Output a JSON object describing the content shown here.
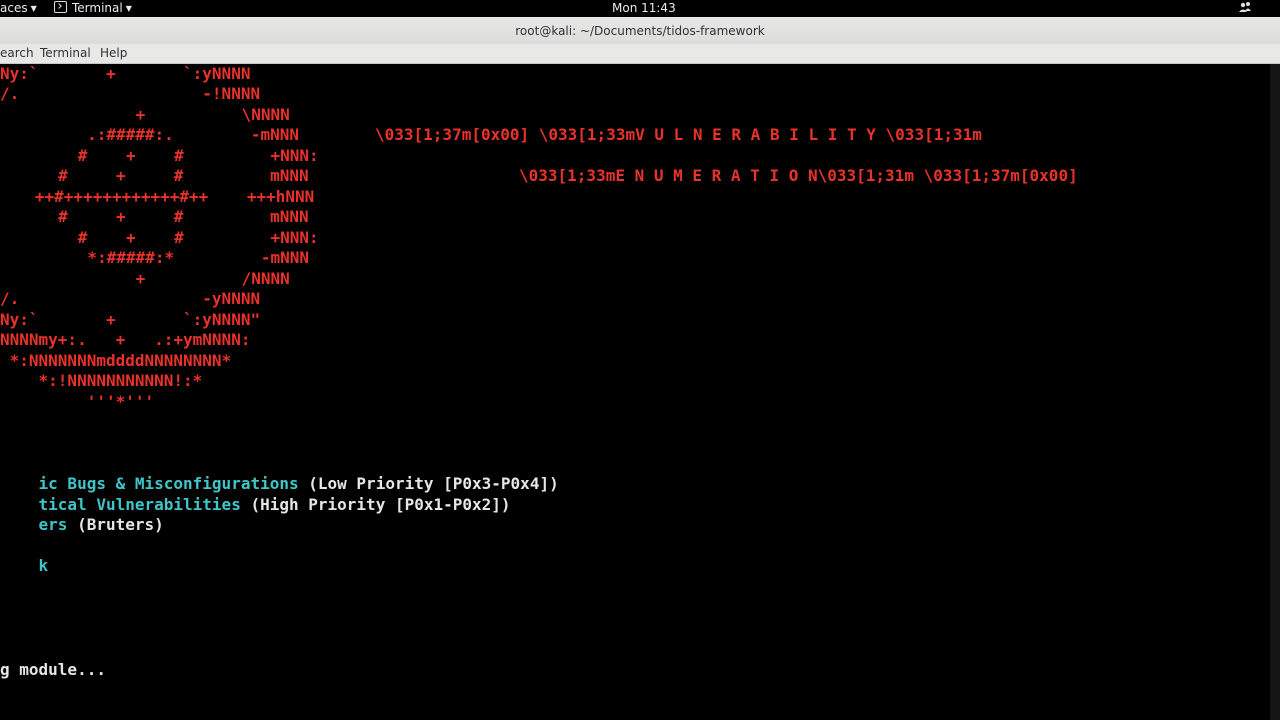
{
  "topbar": {
    "activities": "aces",
    "app_menu": "Terminal",
    "clock": "Mon 11:43",
    "tray_icon": "network-users-icon"
  },
  "window": {
    "title": "root@kali: ~/Documents/tidos-framework"
  },
  "menubar": {
    "search": "earch",
    "terminal": "Terminal",
    "help": "Help"
  },
  "colors": {
    "banner_red": "#e8322b",
    "menu_cyan": "#3fc6c8",
    "text_white": "#e6e6e6"
  },
  "banner_art": [
    "Ny:`       +       `:yNNNN",
    "/.                   -!NNNN",
    "            +          \\NNNN",
    "        .:#####:.        -mNNN",
    "      #    +    #         +NNN:",
    "     #     +     #         mNNN",
    "   ++#++++++++++++#++    +++hNNN",
    "     #     +     #         mNNN",
    "      #    +    #         +NNN:",
    "       *:#####:*         -mNNN",
    "            +          /NNNN",
    "/.                   -yNNNN",
    "Ny:`       +       `:yNNNN\"",
    "NNNNmy+:.   +   .:+ymNNNN:",
    " *:NNNNNNNmddddNNNNNNNN*",
    "    *:!NNNNNNNNNNN!:*",
    "         '''*'''"
  ],
  "banner_text": {
    "line1": "\\033[1;37m[0x00] \\033[1;33mV U L N E R A B I L I T Y \\033[1;31m",
    "line2": "\\033[1;33mE N U M E R A T I O N\\033[1;31m \\033[1;37m[0x00]"
  },
  "menu_options": [
    {
      "label": "ic Bugs & Misconfigurations",
      "note": " (Low Priority [P0x3-P0x4])"
    },
    {
      "label": "tical Vulnerabilities",
      "note": " (High Priority [P0x1-P0x2])"
    },
    {
      "label": "ers",
      "note": " (Bruters)"
    },
    {
      "label": "k",
      "note": ""
    }
  ],
  "status_line": "g module..."
}
